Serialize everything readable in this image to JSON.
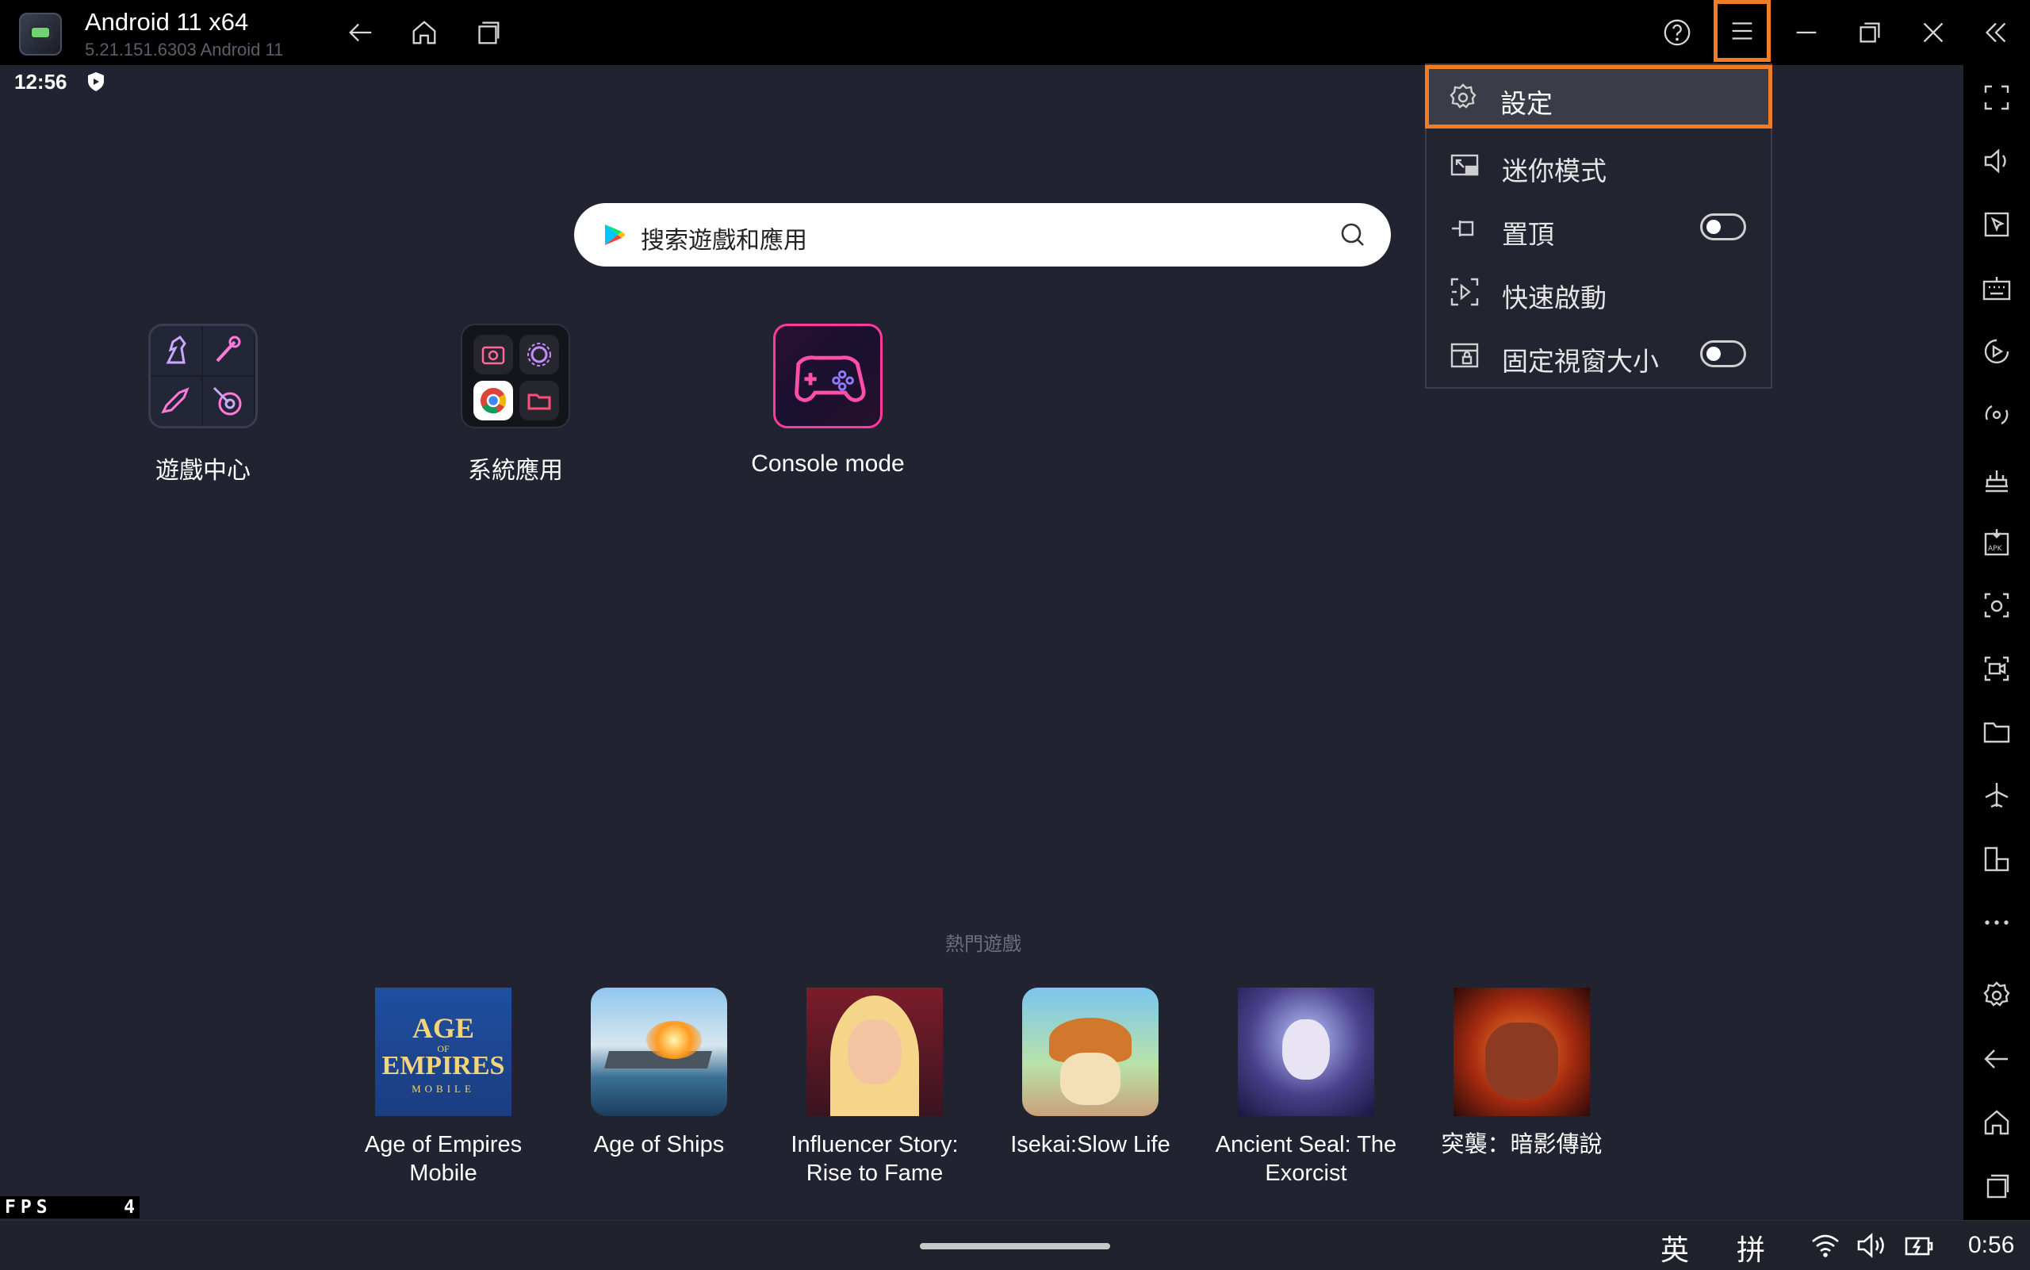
{
  "window": {
    "title": "Android 11 x64",
    "subtitle": "5.21.151.6303  Android 11"
  },
  "status": {
    "time": "12:56"
  },
  "search": {
    "placeholder": "搜索遊戲和應用"
  },
  "apps": [
    {
      "label": "遊戲中心"
    },
    {
      "label": "系統應用"
    },
    {
      "label": "Console mode"
    }
  ],
  "popular": {
    "label": "熱門遊戲",
    "games": [
      {
        "name_l1": "Age of Empires",
        "name_l2": "Mobile",
        "thumb_text_1": "AGE",
        "thumb_text_2": "OF",
        "thumb_text_3": "EMPIRES",
        "thumb_text_4": "MOBILE"
      },
      {
        "name_l1": "Age of Ships",
        "name_l2": ""
      },
      {
        "name_l1": "Influencer Story:",
        "name_l2": "Rise to Fame"
      },
      {
        "name_l1": "Isekai:Slow Life",
        "name_l2": ""
      },
      {
        "name_l1": "Ancient Seal: The",
        "name_l2": "Exorcist"
      },
      {
        "name_l1": "突襲：暗影傳說",
        "name_l2": ""
      }
    ]
  },
  "menu": {
    "items": [
      {
        "label": "設定",
        "icon": "gear-icon"
      },
      {
        "label": "迷你模式",
        "icon": "mini-mode-icon"
      },
      {
        "label": "置頂",
        "icon": "pin-top-icon",
        "toggle": "off"
      },
      {
        "label": "快速啟動",
        "icon": "quick-launch-icon"
      },
      {
        "label": "固定視窗大小",
        "icon": "fixed-window-icon",
        "toggle": "off"
      }
    ]
  },
  "fps": {
    "label": "FPS",
    "value": "4"
  },
  "taskbar": {
    "ime_1": "英",
    "ime_2": "拼",
    "clock": "0:56"
  },
  "colors": {
    "accent": "#f07c23",
    "background": "#212330",
    "titlebar": "#000000"
  }
}
